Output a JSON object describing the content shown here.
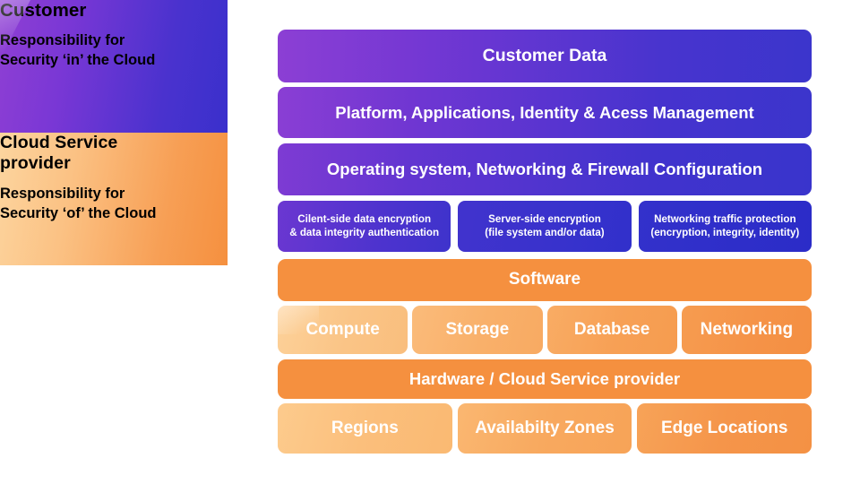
{
  "left_panel": {
    "customer": {
      "title": "Customer",
      "subtitle_line1": "Responsibility for",
      "subtitle_line2": "Security ‘in’ the Cloud",
      "gradient_from": "#8F3FD4",
      "gradient_to": "#3A30CC"
    },
    "provider": {
      "title_line1": "Cloud Service",
      "title_line2": "provider",
      "subtitle_line1": "Responsibility for",
      "subtitle_line2": "Security ‘of’ the Cloud",
      "gradient_from": "#FCD59F",
      "gradient_to": "#F5903F"
    }
  },
  "stack": {
    "customer_layers": [
      {
        "label": "Customer Data"
      },
      {
        "label": "Platform, Applications, Identity & Acess Management"
      },
      {
        "label": "Operating system, Networking & Firewall Configuration"
      }
    ],
    "encryption_row": [
      {
        "line1": "Cilent-side data encryption",
        "line2": "& data integrity authentication"
      },
      {
        "line1": "Server-side encryption",
        "line2": "(file system and/or data)"
      },
      {
        "line1": "Networking traffic protection",
        "line2": "(encryption, integrity, identity)"
      }
    ],
    "software_bar": {
      "label": "Software"
    },
    "services_row": [
      {
        "label": "Compute"
      },
      {
        "label": "Storage"
      },
      {
        "label": "Database"
      },
      {
        "label": "Networking"
      }
    ],
    "hardware_bar": {
      "label": "Hardware / Cloud Service provider"
    },
    "locations_row": [
      {
        "label": "Regions"
      },
      {
        "label": "Availabilty Zones"
      },
      {
        "label": "Edge Locations"
      }
    ]
  },
  "colors": {
    "purple_light": "#8C3FD4",
    "purple_deep": "#2B2CC8",
    "orange_accent": "#F5903F",
    "orange_light": "#FDD199",
    "text_on_fill": "#FFFFFF",
    "background": "#FFFFFF"
  }
}
